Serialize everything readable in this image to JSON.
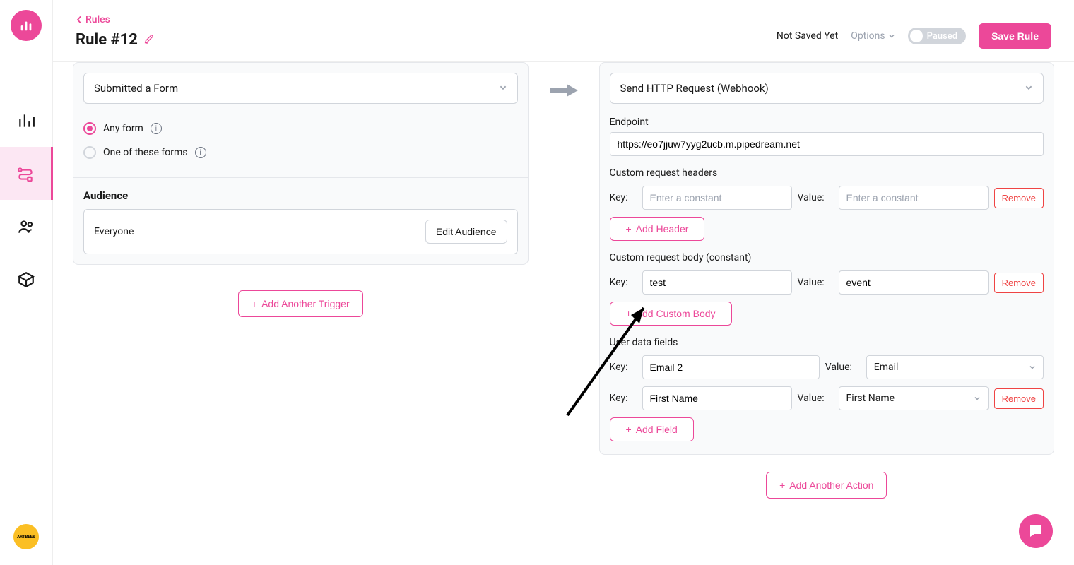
{
  "breadcrumb": {
    "label": "Rules"
  },
  "page": {
    "title": "Rule #12"
  },
  "status": {
    "not_saved": "Not Saved Yet",
    "options": "Options",
    "toggle_label": "Paused",
    "save": "Save Rule"
  },
  "trigger": {
    "select": "Submitted a Form",
    "radio_any": "Any form",
    "radio_one": "One of these forms",
    "audience_header": "Audience",
    "audience_value": "Everyone",
    "edit_audience": "Edit Audience",
    "add_trigger": "Add Another Trigger"
  },
  "action": {
    "select": "Send HTTP Request (Webhook)",
    "endpoint_label": "Endpoint",
    "endpoint_value": "https://eo7jjuw7yyg2ucb.m.pipedream.net",
    "headers_label": "Custom request headers",
    "body_label": "Custom request body (constant)",
    "userfields_label": "User data fields",
    "key_label": "Key:",
    "value_label": "Value:",
    "placeholder": "Enter a constant",
    "remove": "Remove",
    "add_header": "Add Header",
    "add_body": "Add Custom Body",
    "add_field": "Add Field",
    "body_key": "test",
    "body_value": "event",
    "uf1_key": "Email 2",
    "uf1_value": "Email",
    "uf2_key": "First Name",
    "uf2_value": "First Name",
    "add_action": "Add Another Action"
  },
  "badge": {
    "text": "ARTBEES"
  },
  "colors": {
    "accent": "#ec4899",
    "danger": "#ef4444"
  }
}
